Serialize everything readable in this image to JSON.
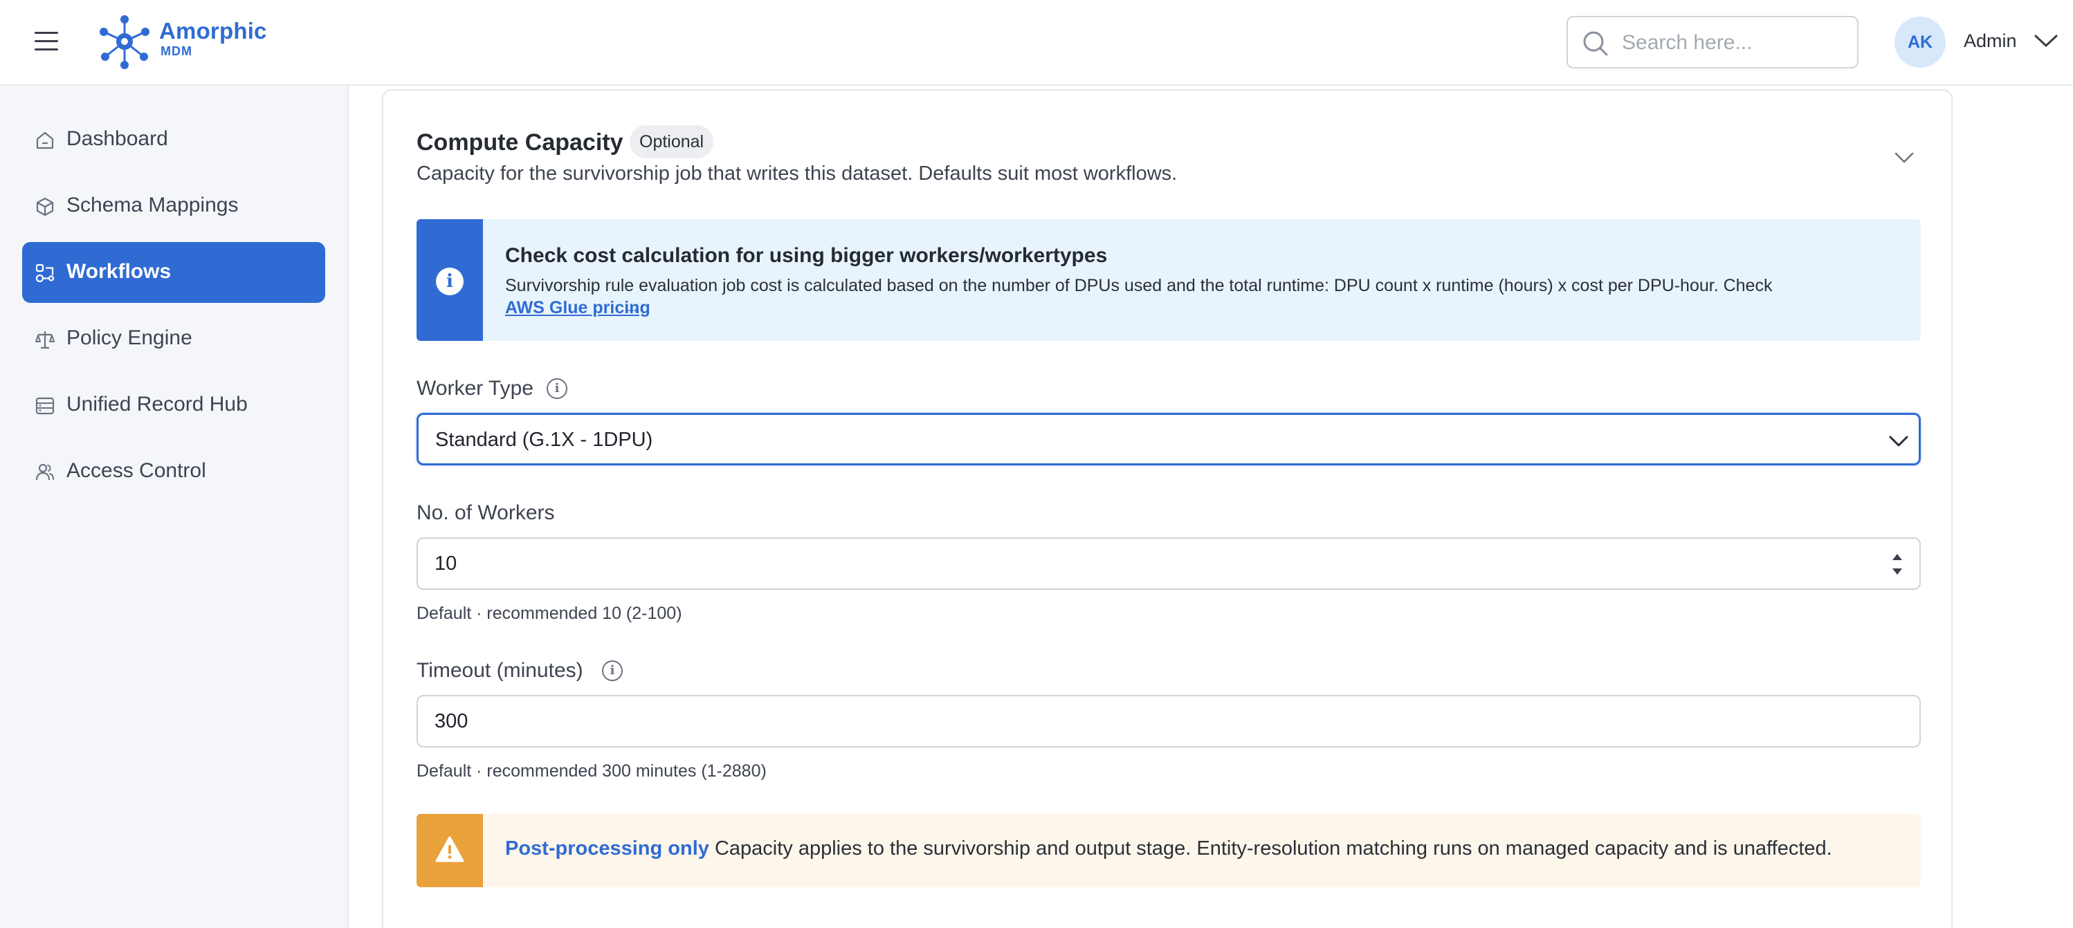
{
  "app": {
    "logo_name": "Amorphic",
    "logo_sub": "MDM",
    "brand_color": "#2f6bd3"
  },
  "header": {
    "search_placeholder": "Search here...",
    "avatar_initials": "AK",
    "user_name": "Admin"
  },
  "sidebar": {
    "items": [
      {
        "label": "Dashboard",
        "icon": "home-icon",
        "active": false
      },
      {
        "label": "Schema Mappings",
        "icon": "cube-icon",
        "active": false
      },
      {
        "label": "Workflows",
        "icon": "workflow-icon",
        "active": true
      },
      {
        "label": "Policy Engine",
        "icon": "scale-icon",
        "active": false
      },
      {
        "label": "Unified Record Hub",
        "icon": "database-icon",
        "active": false
      },
      {
        "label": "Access Control",
        "icon": "users-icon",
        "active": false
      }
    ]
  },
  "section": {
    "title": "Compute Capacity",
    "badge": "Optional",
    "description": "Capacity for the survivorship job that writes this dataset. Defaults suit most workflows."
  },
  "info_banner": {
    "title": "Check cost calculation for using bigger workers/workertypes",
    "text": "Survivorship rule evaluation job cost is calculated based on the number of DPUs used and the total runtime: DPU count x runtime (hours) x cost per DPU-hour. Check",
    "link": "AWS Glue pricing",
    "link_arrow": "→"
  },
  "form": {
    "worker_type": {
      "label": "Worker Type",
      "value": "Standard (G.1X - 1DPU)"
    },
    "num_workers": {
      "label": "No. of Workers",
      "value": "10",
      "hint": "Default · recommended 10 (2-100)"
    },
    "timeout": {
      "label": "Timeout (minutes)",
      "value": "300",
      "hint": "Default · recommended 300 minutes (1-2880)"
    }
  },
  "warning_banner": {
    "strong": "Post-processing only",
    "text": "Capacity applies to the survivorship and output stage. Entity-resolution matching runs on managed capacity and is unaffected."
  }
}
